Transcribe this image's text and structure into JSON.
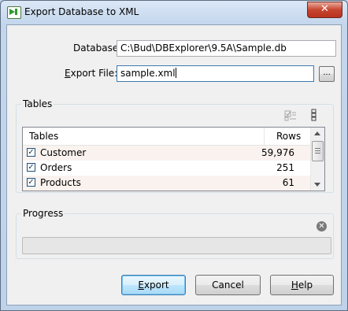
{
  "window": {
    "title": "Export Database to XML",
    "close_label": "✕"
  },
  "form": {
    "database_label": "Database:",
    "database_value": "C:\\Bud\\DBExplorer\\9.5A\\Sample.db",
    "export_file_label": "Export File:",
    "export_file_value": "sample.xml",
    "browse_label": "..."
  },
  "tables_group": {
    "title": "Tables",
    "toolbar_icons": [
      "check-all-icon",
      "column-options-icon"
    ],
    "columns": [
      "Tables",
      "Rows"
    ],
    "rows": [
      {
        "name": "Customer",
        "rows": "59,976",
        "checked": true
      },
      {
        "name": "Orders",
        "rows": "251",
        "checked": true
      },
      {
        "name": "Products",
        "rows": "61",
        "checked": true
      }
    ]
  },
  "progress_group": {
    "title": "Progress",
    "cancel_icon": "cancel-icon",
    "progress": 0
  },
  "buttons": {
    "export": {
      "pre": "",
      "mnemonic": "E",
      "post": "xport"
    },
    "cancel": "Cancel",
    "help": {
      "pre": "",
      "mnemonic": "H",
      "post": "elp"
    }
  },
  "colors": {
    "accent": "#3c7fb1",
    "alt_row": "#f9f2ee",
    "close": "#c7452f"
  }
}
